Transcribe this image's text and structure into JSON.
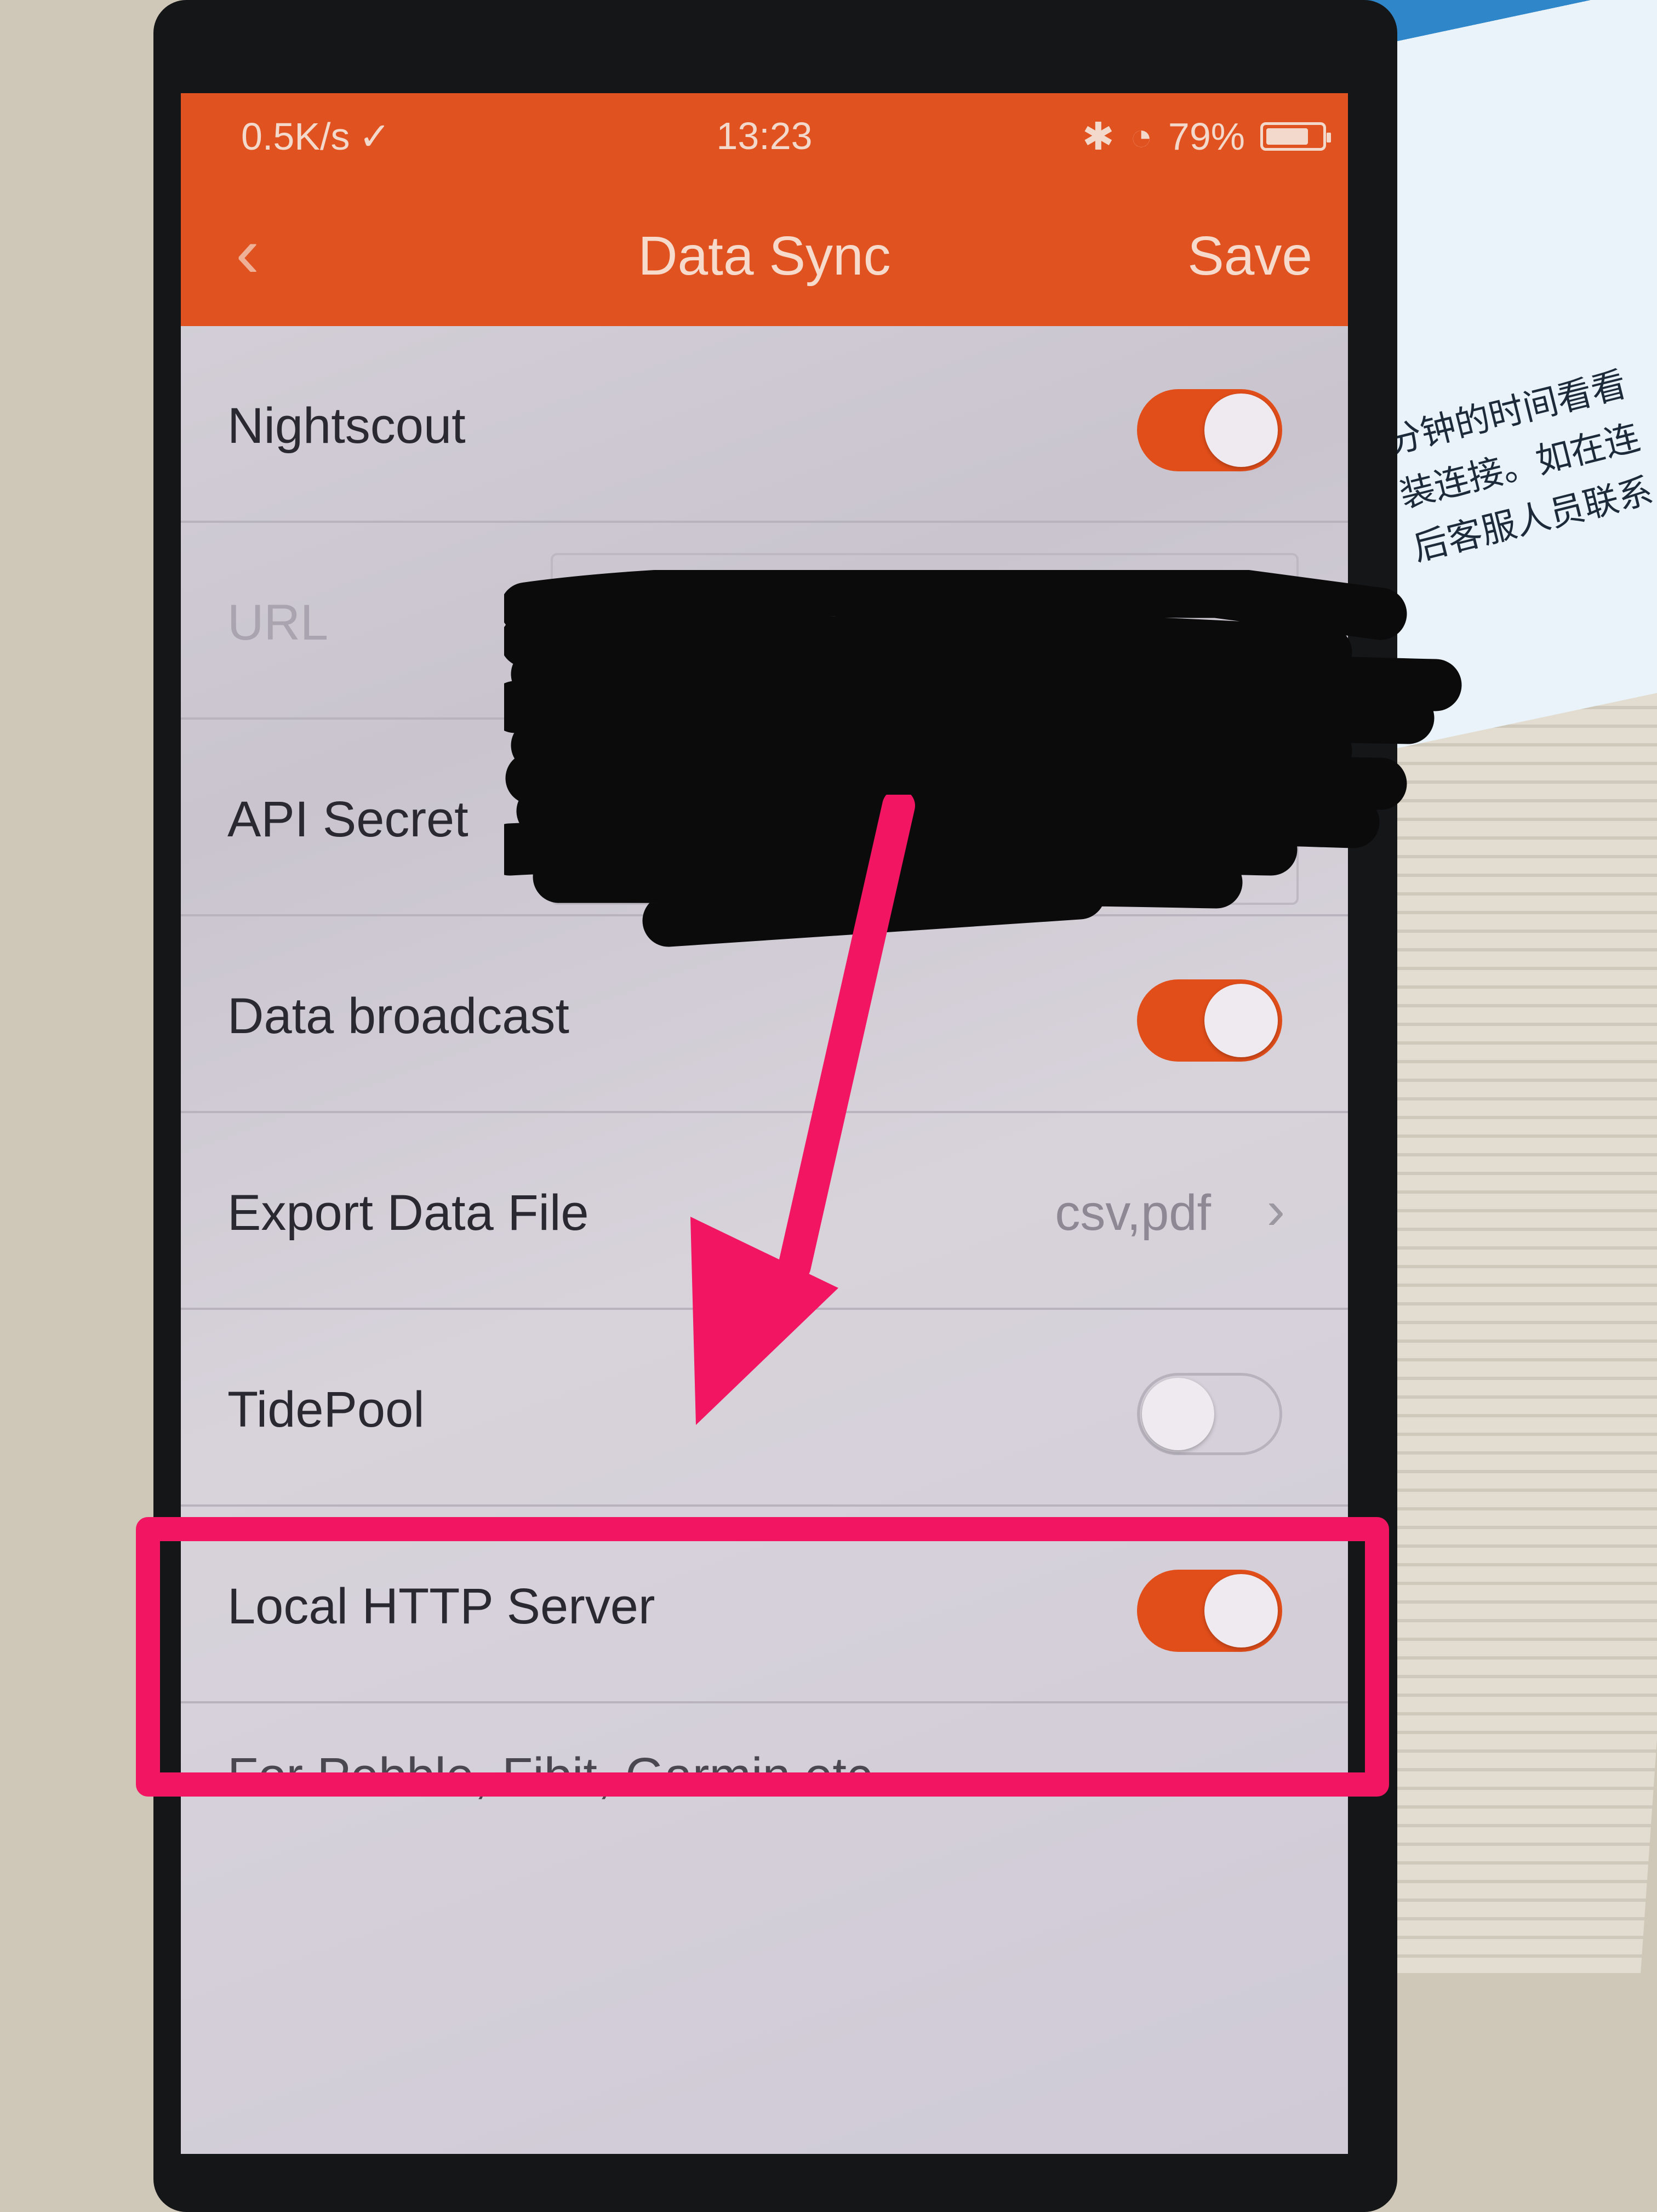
{
  "status_bar": {
    "net_speed": "0.5K/s",
    "time": "13:23",
    "battery_pct": "79%",
    "battery_level": 0.79
  },
  "nav": {
    "back_glyph": "‹",
    "title": "Data Sync",
    "save_label": "Save"
  },
  "settings": {
    "nightscout_label": "Nightscout",
    "nightscout_on": true,
    "url_label": "URL",
    "api_secret_label": "API Secret",
    "data_broadcast_label": "Data broadcast",
    "data_broadcast_on": true,
    "export_label": "Export Data File",
    "export_value": "csv,pdf",
    "tidepool_label": "TidePool",
    "tidepool_on": false,
    "local_http_label": "Local HTTP Server",
    "local_http_on": true,
    "local_http_note": "For Pebble, Fibit, Garmin etc."
  },
  "brochure_lines": [
    "分钟的时间看看",
    "装连接。如在连",
    "后客服人员联系"
  ],
  "colors": {
    "accent": "#e0521f",
    "annotation": "#f11562"
  }
}
